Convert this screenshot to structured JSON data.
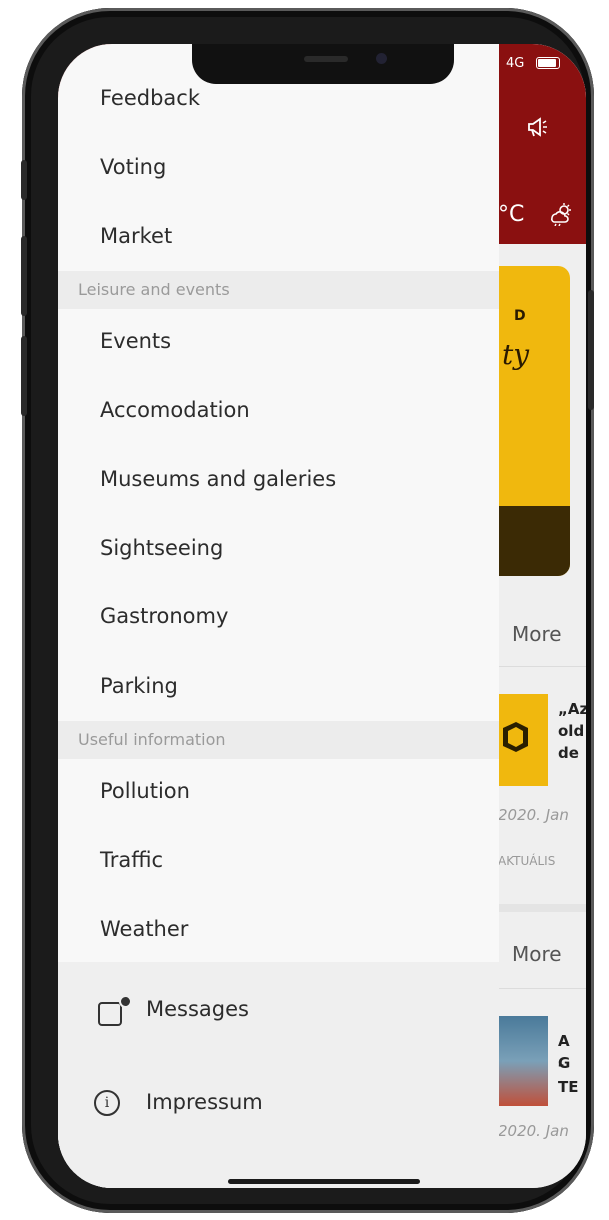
{
  "status_bar": {
    "network": "4G"
  },
  "background_app": {
    "temperature_suffix": "°C",
    "banner_letter": "D",
    "banner_script": "ty",
    "more_label_1": "More",
    "more_label_2": "More",
    "news_1": {
      "title": [
        "„Az",
        "old",
        "de"
      ],
      "date": "2020. Jan",
      "tag": "AKTUÁLIS"
    },
    "news_2": {
      "title": [
        "A G",
        "- TE"
      ],
      "date": "2020. Jan"
    }
  },
  "drawer": {
    "top_items": [
      "Feedback",
      "Voting",
      "Market"
    ],
    "sections": [
      {
        "label": "Leisure and events",
        "items": [
          "Events",
          "Accomodation",
          "Museums and galeries",
          "Sightseeing",
          "Gastronomy",
          "Parking"
        ]
      },
      {
        "label": "Useful information",
        "items": [
          "Pollution",
          "Traffic",
          "Weather"
        ]
      }
    ],
    "footer": {
      "messages_label": "Messages",
      "impressum_label": "Impressum"
    }
  },
  "colors": {
    "header_red": "#8a1010",
    "accent_yellow": "#f0b80e",
    "drawer_bg": "#f8f8f8",
    "section_bg": "#ececec"
  },
  "icons": [
    "megaphone-icon",
    "weather-icon",
    "messages-icon",
    "info-icon",
    "battery-icon"
  ]
}
